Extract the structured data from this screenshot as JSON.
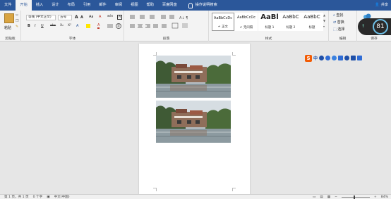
{
  "menubar": {
    "tabs": [
      "文件",
      "开始",
      "插入",
      "设计",
      "布局",
      "引用",
      "邮件",
      "审阅",
      "视图",
      "帮助",
      "百度网盘"
    ],
    "active_tab": "开始",
    "tell_me": "操作说明搜索",
    "share": "共享"
  },
  "ribbon": {
    "clipboard": {
      "paste": "粘贴",
      "label": "剪贴板"
    },
    "font": {
      "font_name": "等线 (中文正文)",
      "font_size": "五号",
      "grow": "A",
      "shrink": "A",
      "case": "Aa",
      "clear": "A",
      "wen": "wén",
      "biu": [
        "B",
        "I",
        "U"
      ],
      "strike": "abc",
      "sub": "X₂",
      "sup": "X²",
      "color_a": "A",
      "label": "字体"
    },
    "paragraph": {
      "label": "段落"
    },
    "styles": {
      "items": [
        {
          "preview": "AaBbCcDc",
          "name": "↵ 正文"
        },
        {
          "preview": "AaBbCcDc",
          "name": "↵ 无间隔"
        },
        {
          "preview": "AaBl",
          "name": "标题 1"
        },
        {
          "preview": "AaBbC",
          "name": "标题 2"
        },
        {
          "preview": "AaBbC",
          "name": "标题"
        }
      ],
      "label": "样式"
    },
    "editing": {
      "find": "查找",
      "replace": "替换",
      "select": "选择",
      "label": "编辑"
    },
    "save": {
      "label": "保存"
    }
  },
  "score_widget": {
    "value": "81"
  },
  "ime_toolbar": {
    "logo": "S",
    "mode": "中"
  },
  "status": {
    "page": "第 1 页，共 1 页",
    "words": "0 个字",
    "lang": "中文(中国)",
    "zoom": "84%"
  },
  "colors": {
    "brand": "#2b579a",
    "ribbon_bg": "#f3f3f3",
    "canvas_bg": "#e6e6e6"
  }
}
